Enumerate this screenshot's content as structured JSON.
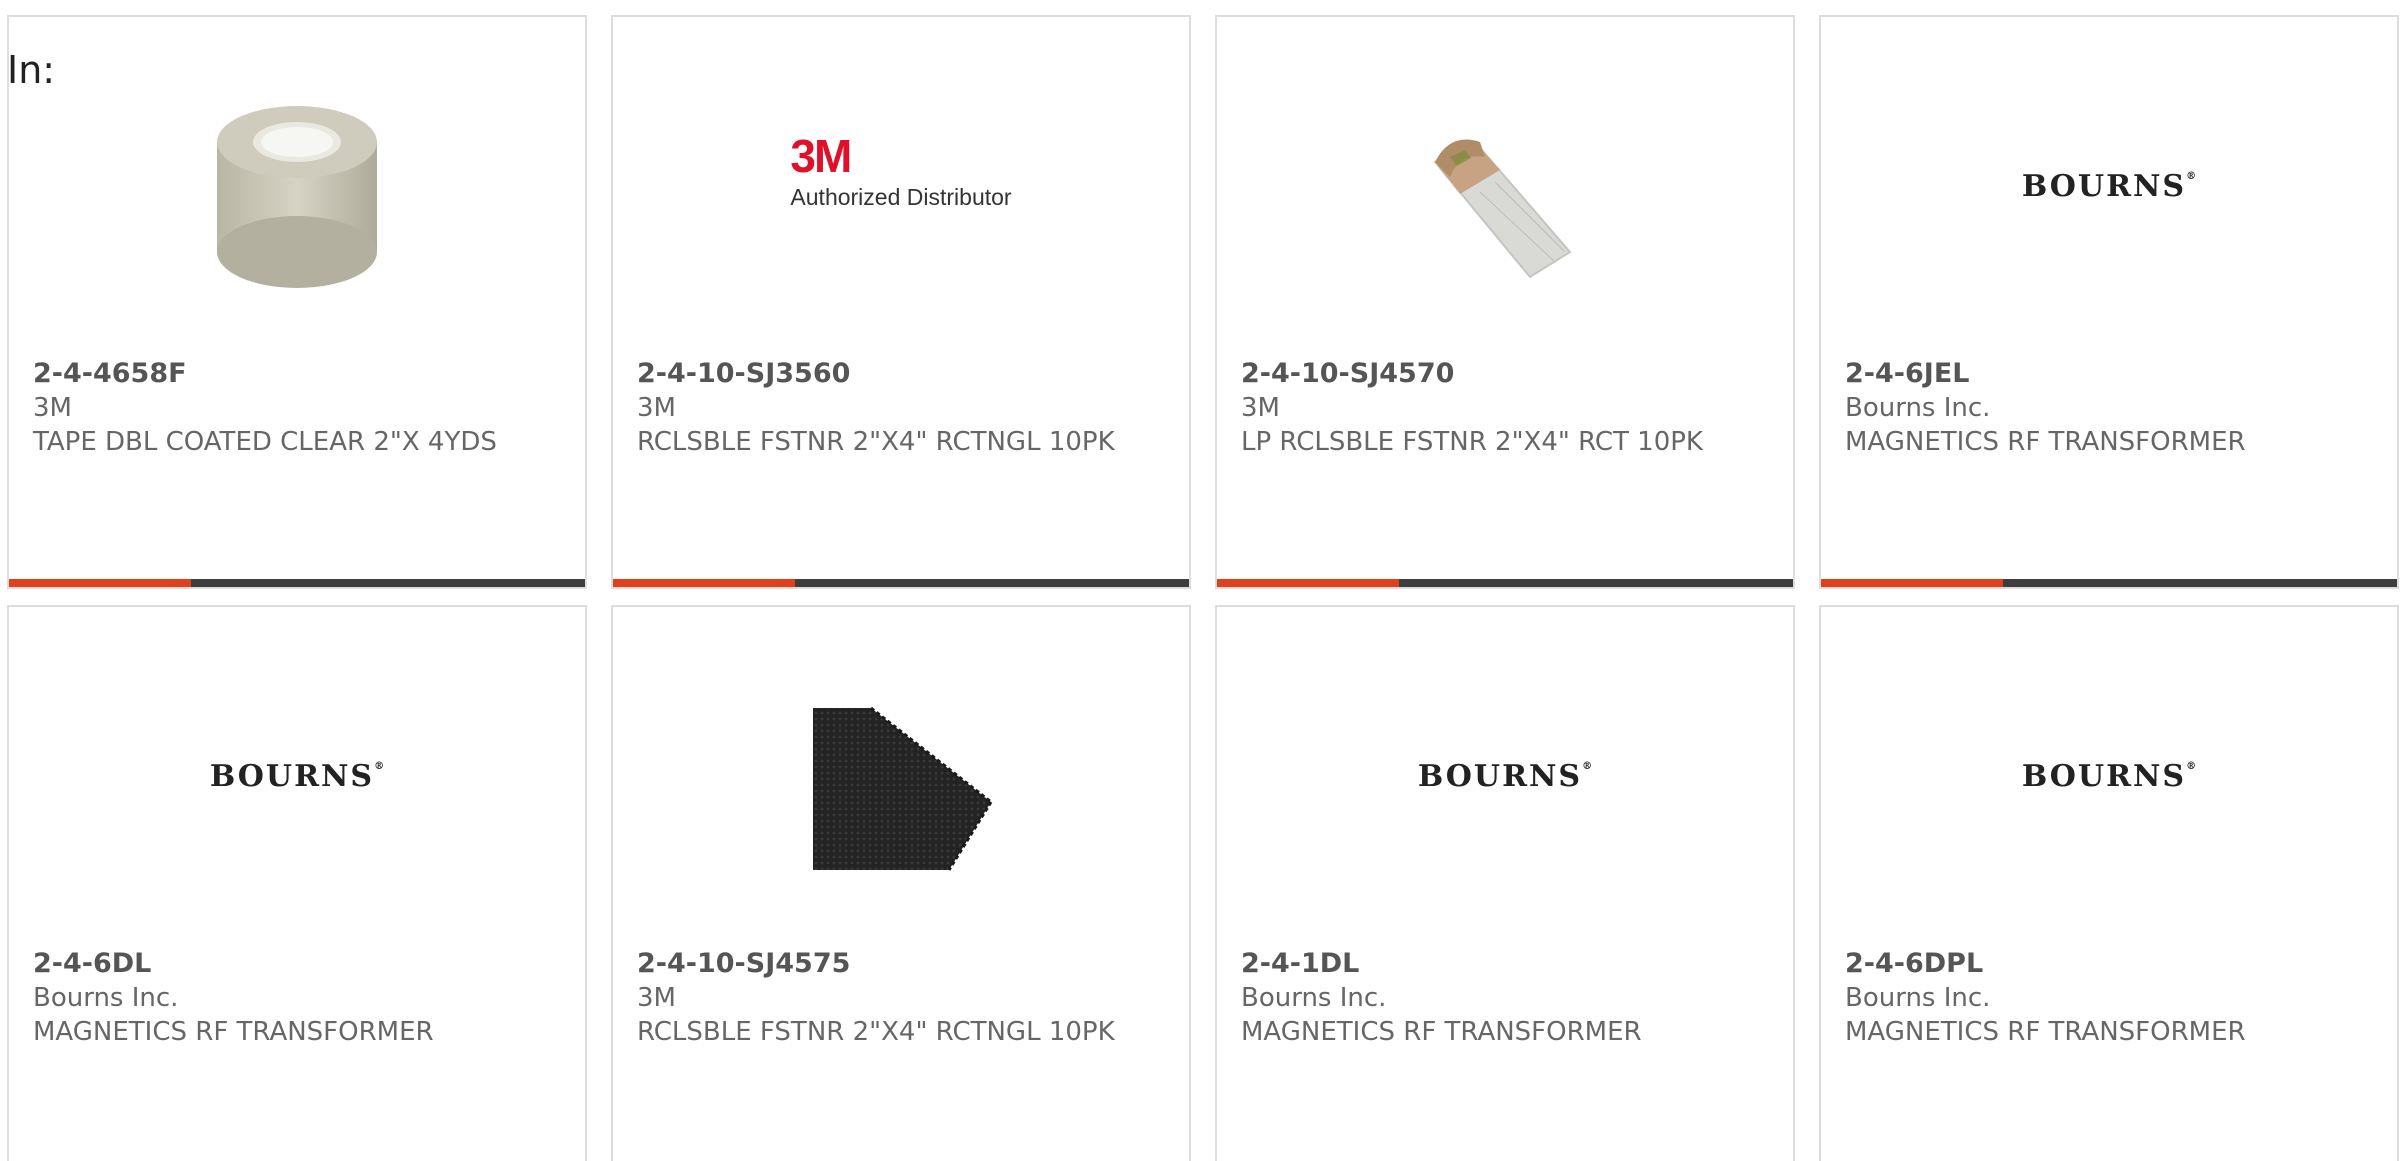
{
  "filter": {
    "label": "In:"
  },
  "products": [
    {
      "part_number": "2-4-4658F",
      "manufacturer": "3M",
      "description": "TAPE DBL COATED CLEAR 2\"X 4YDS",
      "image": "tape-roll-image"
    },
    {
      "part_number": "2-4-10-SJ3560",
      "manufacturer": "3M",
      "description": "RCLSBLE FSTNR 2\"X4\" RCTNGL 10PK",
      "image": "3m-authorized-distributor-logo",
      "logo_mark": "3M",
      "logo_sub": "Authorized Distributor"
    },
    {
      "part_number": "2-4-10-SJ4570",
      "manufacturer": "3M",
      "description": "LP RCLSBLE FSTNR 2\"X4\" RCT 10PK",
      "image": "fastener-strip-image"
    },
    {
      "part_number": "2-4-6JEL",
      "manufacturer": "Bourns Inc.",
      "description": "MAGNETICS RF TRANSFORMER",
      "image": "bourns-logo",
      "logo_text": "BOURNS"
    },
    {
      "part_number": "2-4-6DL",
      "manufacturer": "Bourns Inc.",
      "description": "MAGNETICS RF TRANSFORMER",
      "image": "bourns-logo",
      "logo_text": "BOURNS"
    },
    {
      "part_number": "2-4-10-SJ4575",
      "manufacturer": "3M",
      "description": "RCLSBLE FSTNR 2\"X4\" RCTNGL 10PK",
      "image": "black-fastener-image"
    },
    {
      "part_number": "2-4-1DL",
      "manufacturer": "Bourns Inc.",
      "description": "MAGNETICS RF TRANSFORMER",
      "image": "bourns-logo",
      "logo_text": "BOURNS"
    },
    {
      "part_number": "2-4-6DPL",
      "manufacturer": "Bourns Inc.",
      "description": "MAGNETICS RF TRANSFORMER",
      "image": "bourns-logo",
      "logo_text": "BOURNS"
    }
  ],
  "colors": {
    "accent": "#e0401b",
    "bar": "#3d3d3d",
    "border": "#dddddd",
    "text": "#666666",
    "brand_3m": "#e0102a"
  }
}
